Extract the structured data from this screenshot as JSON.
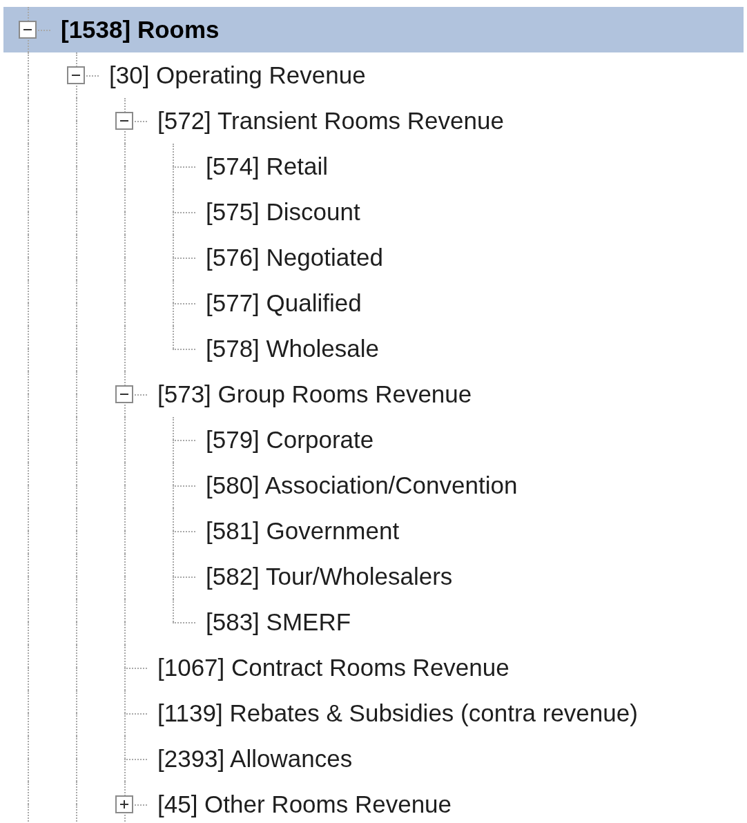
{
  "tree": {
    "items": [
      {
        "label": "[1538] Rooms",
        "kind": "folder",
        "expanded": true,
        "selected": true,
        "children": [
          {
            "label": "[30] Operating Revenue",
            "kind": "folder",
            "expanded": true,
            "selected": false,
            "children": [
              {
                "label": "[572] Transient Rooms Revenue",
                "kind": "folder",
                "expanded": true,
                "selected": false,
                "children": [
                  {
                    "label": "[574] Retail",
                    "kind": "leaf",
                    "selected": false
                  },
                  {
                    "label": "[575] Discount",
                    "kind": "leaf",
                    "selected": false
                  },
                  {
                    "label": "[576] Negotiated",
                    "kind": "leaf",
                    "selected": false
                  },
                  {
                    "label": "[577] Qualified",
                    "kind": "leaf",
                    "selected": false
                  },
                  {
                    "label": "[578] Wholesale",
                    "kind": "leaf",
                    "selected": false
                  }
                ]
              },
              {
                "label": "[573] Group Rooms Revenue",
                "kind": "folder",
                "expanded": true,
                "selected": false,
                "children": [
                  {
                    "label": "[579] Corporate",
                    "kind": "leaf",
                    "selected": false
                  },
                  {
                    "label": "[580] Association/Convention",
                    "kind": "leaf",
                    "selected": false
                  },
                  {
                    "label": "[581] Government",
                    "kind": "leaf",
                    "selected": false
                  },
                  {
                    "label": "[582] Tour/Wholesalers",
                    "kind": "leaf",
                    "selected": false
                  },
                  {
                    "label": "[583] SMERF",
                    "kind": "leaf",
                    "selected": false
                  }
                ]
              },
              {
                "label": "[1067] Contract Rooms Revenue",
                "kind": "leaf",
                "selected": false
              },
              {
                "label": "[1139] Rebates & Subsidies (contra revenue)",
                "kind": "leaf",
                "selected": false
              },
              {
                "label": "[2393] Allowances",
                "kind": "leaf",
                "selected": false
              },
              {
                "label": "[45] Other Rooms Revenue",
                "kind": "folder",
                "expanded": false,
                "selected": false
              }
            ]
          }
        ]
      }
    ]
  }
}
